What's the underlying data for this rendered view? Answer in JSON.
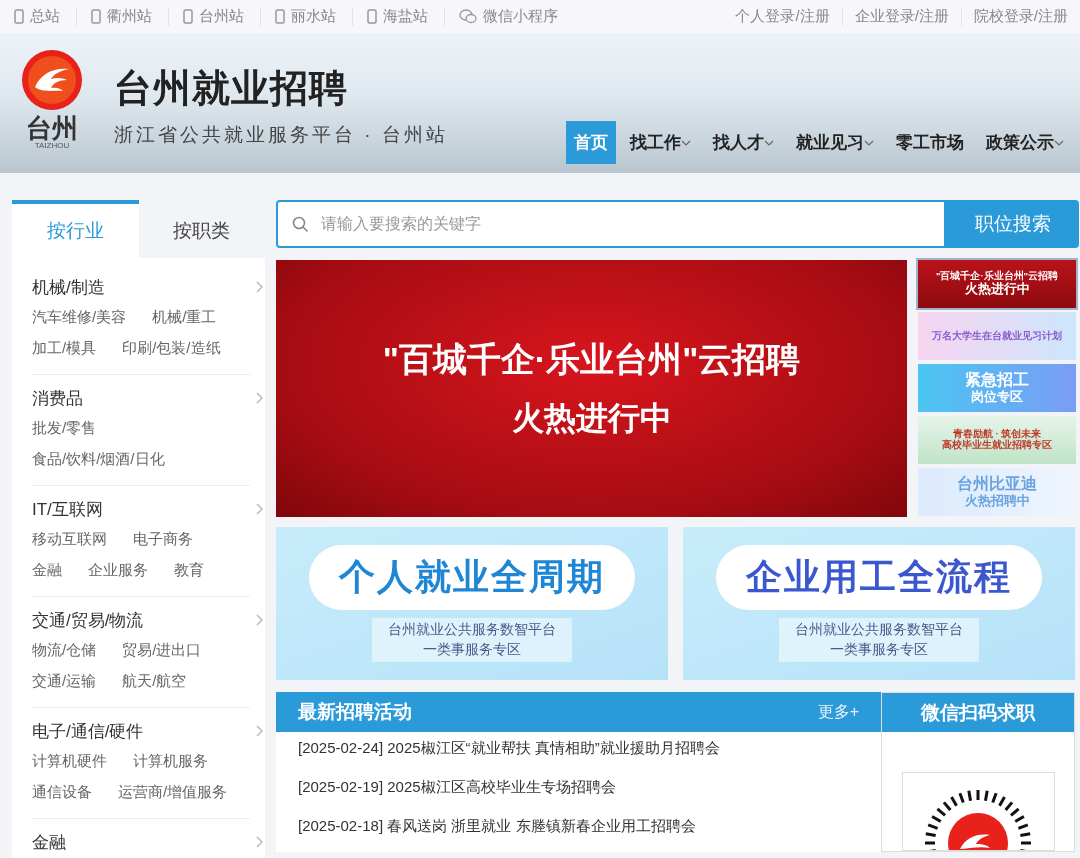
{
  "topbar": {
    "sites": [
      {
        "label": "总站",
        "kind": "phone"
      },
      {
        "label": "衢州站",
        "kind": "phone"
      },
      {
        "label": "台州站",
        "kind": "phone"
      },
      {
        "label": "丽水站",
        "kind": "phone"
      },
      {
        "label": "海盐站",
        "kind": "phone"
      },
      {
        "label": "微信小程序",
        "kind": "wechat"
      }
    ],
    "logins": [
      "个人登录/注册",
      "企业登录/注册",
      "院校登录/注册"
    ]
  },
  "header": {
    "logo_text": "台州",
    "logo_subtext": "TAIZHOU",
    "title": "台州就业招聘",
    "subtitle": "浙江省公共就业服务平台 · 台州站",
    "nav": [
      {
        "label": "首页",
        "selected": true,
        "dropdown": false
      },
      {
        "label": "找工作",
        "selected": false,
        "dropdown": true
      },
      {
        "label": "找人才",
        "selected": false,
        "dropdown": true
      },
      {
        "label": "就业见习",
        "selected": false,
        "dropdown": true
      },
      {
        "label": "零工市场",
        "selected": false,
        "dropdown": false
      },
      {
        "label": "政策公示",
        "selected": false,
        "dropdown": true
      }
    ]
  },
  "sidebar": {
    "tabs": [
      {
        "label": "按行业",
        "selected": true
      },
      {
        "label": "按职类",
        "selected": false
      }
    ],
    "categories": [
      {
        "title": "机械/制造",
        "rows": [
          [
            "汽车维修/美容",
            "机械/重工"
          ],
          [
            "加工/模具",
            "印刷/包装/造纸"
          ]
        ]
      },
      {
        "title": "消费品",
        "rows": [
          [
            "批发/零售"
          ],
          [
            "食品/饮料/烟酒/日化"
          ]
        ]
      },
      {
        "title": "IT/互联网",
        "rows": [
          [
            "移动互联网",
            "电子商务"
          ],
          [
            "金融",
            "企业服务",
            "教育"
          ]
        ]
      },
      {
        "title": "交通/贸易/物流",
        "rows": [
          [
            "物流/仓储",
            "贸易/进出口"
          ],
          [
            "交通/运输",
            "航天/航空"
          ]
        ]
      },
      {
        "title": "电子/通信/硬件",
        "rows": [
          [
            "计算机硬件",
            "计算机服务"
          ],
          [
            "通信设备",
            "运营商/增值服务"
          ]
        ]
      },
      {
        "title": "金融"
      }
    ]
  },
  "search": {
    "placeholder": "请输入要搜索的关键字",
    "button": "职位搜索"
  },
  "banner": {
    "line1": "\"百城千企·乐业台州\"云招聘",
    "line2": "火热进行中"
  },
  "thumbnails": [
    {
      "kind": "red",
      "lines": [
        "\"百城千企·乐业台州\"云招聘",
        "火热进行中"
      ],
      "selected": true
    },
    {
      "kind": "pink",
      "lines": [
        "万名大学生在台就业见习计划"
      ],
      "selected": false
    },
    {
      "kind": "blue",
      "lines": [
        "紧急招工",
        "岗位专区"
      ],
      "selected": false
    },
    {
      "kind": "green",
      "lines": [
        "青春励航 · 筑创未来",
        "高校毕业生就业招聘专区"
      ],
      "selected": false
    },
    {
      "kind": "pale",
      "lines": [
        "台州比亚迪",
        "火热招聘中"
      ],
      "selected": false
    }
  ],
  "promos": [
    {
      "title": "个人就业全周期",
      "subtitle": [
        "台州就业公共服务数智平台",
        "一类事服务专区"
      ]
    },
    {
      "title": "企业用工全流程",
      "subtitle": [
        "台州就业公共服务数智平台",
        "一类事服务专区"
      ]
    }
  ],
  "news": {
    "title": "最新招聘活动",
    "more": "更多+",
    "items": [
      "[2025-02-24] 2025椒江区“就业帮扶 真情相助”就业援助月招聘会",
      "[2025-02-19] 2025椒江区高校毕业生专场招聘会",
      "[2025-02-18] 春风送岗 浙里就业 东塍镇新春企业用工招聘会"
    ]
  },
  "wechat": {
    "title": "微信扫码求职"
  }
}
